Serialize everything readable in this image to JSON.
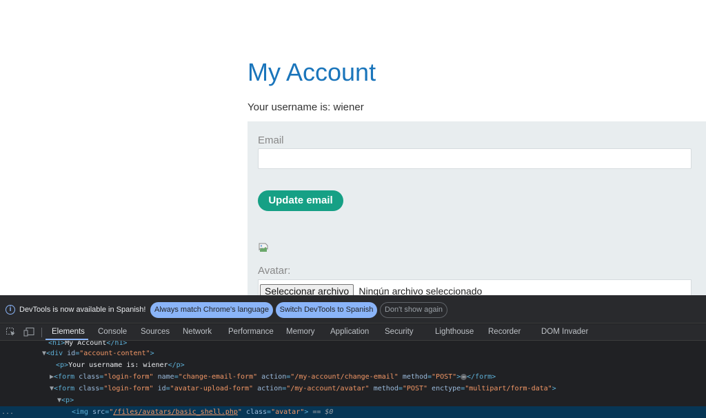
{
  "page": {
    "title": "My Account",
    "username_text": "Your username is: wiener",
    "email_label": "Email",
    "email_value": "",
    "update_button": "Update email",
    "avatar_label": "Avatar:",
    "file_button": "Seleccionar archivo",
    "file_status": "Ningún archivo seleccionado",
    "colors": {
      "title": "#1a75bb",
      "button": "#16a085",
      "panel": "#e8edef"
    }
  },
  "devtools": {
    "infobar": {
      "icon": "info-icon",
      "message": "DevTools is now available in Spanish!",
      "btn_match": "Always match Chrome's language",
      "btn_switch": "Switch DevTools to Spanish",
      "btn_dismiss": "Don't show again"
    },
    "toolbar_icons": [
      "inspect-element-icon",
      "device-toolbar-icon"
    ],
    "tabs": [
      "Elements",
      "Console",
      "Sources",
      "Network",
      "Performance",
      "Memory",
      "Application",
      "Security",
      "Lighthouse",
      "Recorder",
      "DOM Invader"
    ],
    "active_tab": "Elements",
    "dom": {
      "l1_open": "<h1>",
      "l1_text": "My Account",
      "l1_close": "</h1>",
      "l2_tag": "<div",
      "l2_attr": "id",
      "l2_val": "\"account-content\"",
      "l2_end": ">",
      "l3_open": "<p>",
      "l3_text": "Your username is: wiener",
      "l3_close": "</p>",
      "l4_tag": "<form",
      "l4_a1": "class",
      "l4_v1": "\"login-form\"",
      "l4_a2": "name",
      "l4_v2": "\"change-email-form\"",
      "l4_a3": "action",
      "l4_v3": "\"/my-account/change-email\"",
      "l4_a4": "method",
      "l4_v4": "\"POST\"",
      "l4_end": ">",
      "l4_ellipsis": "⋯",
      "l4_close": "</form>",
      "l5_tag": "<form",
      "l5_a1": "class",
      "l5_v1": "\"login-form\"",
      "l5_a2": "id",
      "l5_v2": "\"avatar-upload-form\"",
      "l5_a3": "action",
      "l5_v3": "\"/my-account/avatar\"",
      "l5_a4": "method",
      "l5_v4": "\"POST\"",
      "l5_a5": "enctype",
      "l5_v5": "\"multipart/form-data\"",
      "l5_end": ">",
      "l6_open": "<p>",
      "l7_tag": "<img",
      "l7_a1": "src",
      "l7_q1": "\"",
      "l7_v1": "/files/avatars/basic_shell.php",
      "l7_q2": "\"",
      "l7_a2": "class",
      "l7_v2": "\"avatar\"",
      "l7_end": ">",
      "l7_marker": "== $0",
      "gutter": "..."
    }
  }
}
